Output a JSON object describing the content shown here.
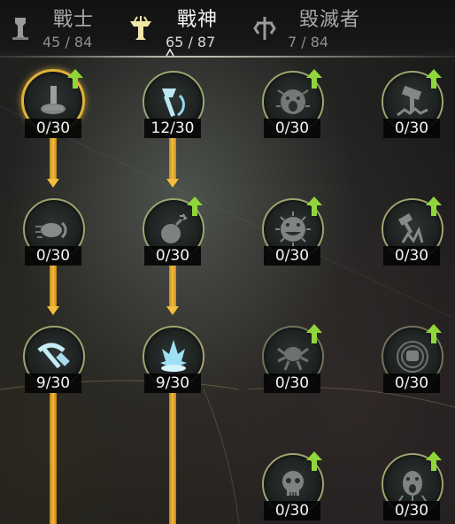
{
  "tabs": [
    {
      "name": "戰士",
      "count": "45 / 84",
      "icon": "warrior-class-icon",
      "active": false
    },
    {
      "name": "戰神",
      "count": "65 / 87",
      "icon": "wargod-class-icon",
      "active": true
    },
    {
      "name": "毀滅者",
      "count": "7 / 84",
      "icon": "destroyer-class-icon",
      "active": false
    }
  ],
  "skills": [
    {
      "level": "0/30",
      "icon": "piston-icon",
      "upgradable": true,
      "selected": true
    },
    {
      "level": "12/30",
      "icon": "axe-swing-icon",
      "upgradable": false
    },
    {
      "level": "0/30",
      "icon": "roaring-face-icon",
      "upgradable": true
    },
    {
      "level": "0/30",
      "icon": "hammer-smash-icon",
      "upgradable": true
    },
    {
      "level": "0/30",
      "icon": "fist-strike-icon",
      "upgradable": false
    },
    {
      "level": "0/30",
      "icon": "bomb-icon",
      "upgradable": true
    },
    {
      "level": "0/30",
      "icon": "grinning-face-icon",
      "upgradable": true
    },
    {
      "level": "0/30",
      "icon": "hammer-burst-icon",
      "upgradable": true
    },
    {
      "level": "9/30",
      "icon": "pickaxe-hammer-icon",
      "upgradable": false
    },
    {
      "level": "9/30",
      "icon": "ice-burst-icon",
      "upgradable": false
    },
    {
      "level": "0/30",
      "icon": "spider-icon",
      "upgradable": true
    },
    {
      "level": "0/30",
      "icon": "vortex-fist-icon",
      "upgradable": true
    },
    {
      "level": "0/30",
      "icon": "skull-icon",
      "upgradable": true
    },
    {
      "level": "0/30",
      "icon": "screaming-spirit-icon",
      "upgradable": true
    }
  ]
}
